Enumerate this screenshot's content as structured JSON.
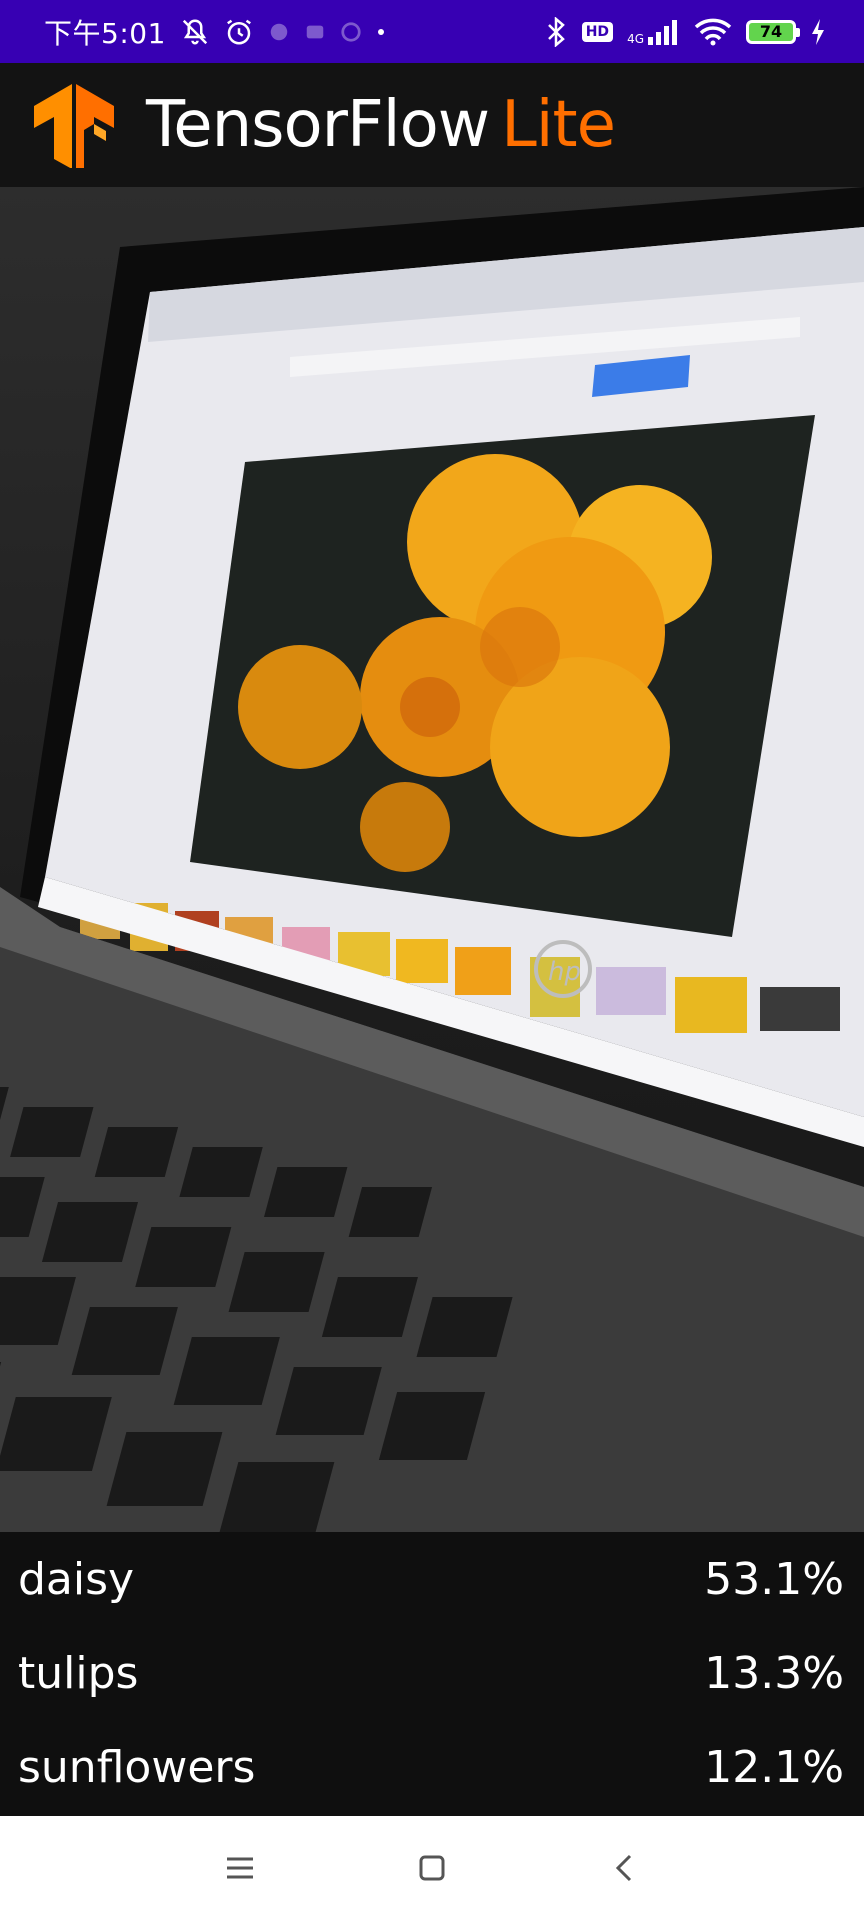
{
  "status_bar": {
    "time": "下午5:01",
    "network": "4G",
    "hd": "HD",
    "battery": "74"
  },
  "header": {
    "brand_main": "TensorFlow",
    "brand_accent": "Lite",
    "accent_color": "#ff6f00"
  },
  "results": [
    {
      "label": "daisy",
      "value": "53.1%"
    },
    {
      "label": "tulips",
      "value": "13.3%"
    },
    {
      "label": "sunflowers",
      "value": "12.1%"
    }
  ],
  "nav": {
    "icons": [
      "menu-icon",
      "home-icon",
      "back-icon"
    ]
  }
}
